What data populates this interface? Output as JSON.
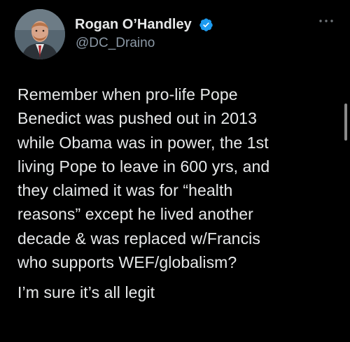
{
  "tweet": {
    "author": {
      "display_name": "Rogan O’Handley",
      "handle": "@DC_Draino",
      "verified": true,
      "avatar_icon": "profile-photo"
    },
    "more_icon": "more-options-icon",
    "lines": [
      "Remember when pro-life Pope",
      "Benedict was pushed out in 2013",
      "while Obama was in power, the 1st",
      "living Pope to leave in 600 yrs, and",
      "they claimed it was for “health",
      "reasons” except he lived another",
      "decade & was replaced w/Francis",
      "who supports WEF/globalism?"
    ],
    "closing_line": "I’m sure it’s all legit"
  },
  "colors": {
    "background": "#000000",
    "text": "#e7e9ea",
    "secondary_text": "#8b98a5",
    "verified_badge": "#1d9bf0"
  }
}
